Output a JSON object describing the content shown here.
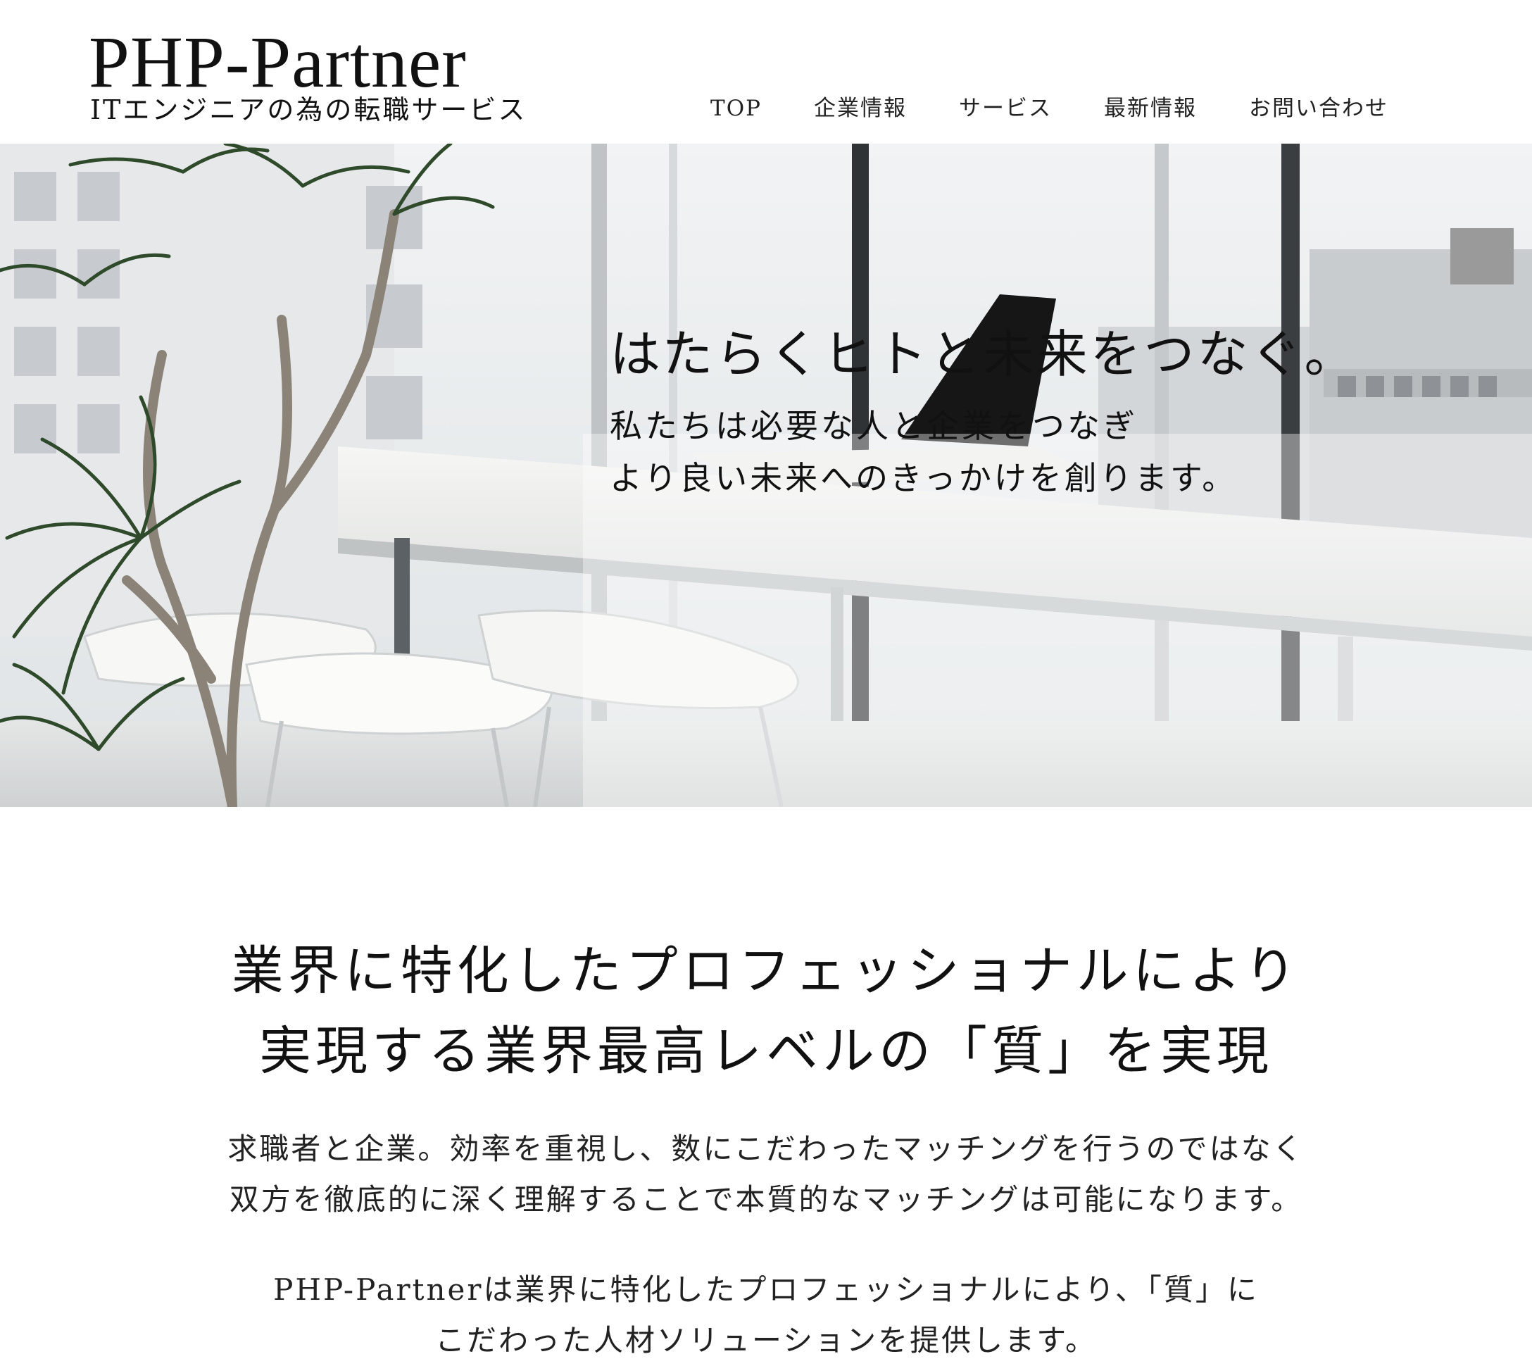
{
  "header": {
    "logo_title": "PHP-Partner",
    "logo_tagline": "ITエンジニアの為の転職サービス",
    "nav": [
      {
        "label": "TOP"
      },
      {
        "label": "企業情報"
      },
      {
        "label": "サービス"
      },
      {
        "label": "最新情報"
      },
      {
        "label": "お問い合わせ"
      }
    ]
  },
  "hero": {
    "headline": "はたらくヒトと未来をつなぐ。",
    "sub_lines": [
      "私たちは必要な人と企業をつなぎ",
      "より良い未来へのきっかけを創ります。"
    ]
  },
  "intro": {
    "heading_lines": [
      "業界に特化したプロフェッショナルにより",
      "実現する業界最高レベルの「質」を実現"
    ],
    "paragraph1_lines": [
      "求職者と企業。効率を重視し、数にこだわったマッチングを行うのではなく",
      "双方を徹底的に深く理解することで本質的なマッチングは可能になります。"
    ],
    "paragraph2_lines": [
      "PHP-Partnerは業界に特化したプロフェッショナルにより、「質」に",
      "こだわった人材ソリューションを提供します。"
    ]
  }
}
